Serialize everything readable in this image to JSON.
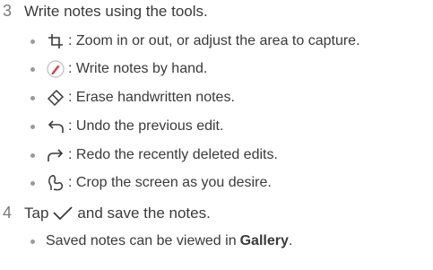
{
  "steps": [
    {
      "number": "3",
      "text": "Write notes using the tools.",
      "bullets": [
        {
          "icon": "crop-icon",
          "text": ": Zoom in or out, or adjust the area to capture."
        },
        {
          "icon": "pen-icon",
          "text": ": Write notes by hand."
        },
        {
          "icon": "eraser-icon",
          "text": ": Erase handwritten notes."
        },
        {
          "icon": "undo-icon",
          "text": ": Undo the previous edit."
        },
        {
          "icon": "redo-icon",
          "text": ": Redo the recently deleted edits."
        },
        {
          "icon": "lasso-icon",
          "text": ": Crop the screen as you desire."
        }
      ]
    },
    {
      "number": "4",
      "text_before": "Tap",
      "icon": "checkmark-icon",
      "text_after": "and save the notes.",
      "bullets": [
        {
          "text_before": "Saved notes can be viewed in",
          "bold": "Gallery",
          "text_after": "."
        }
      ]
    }
  ],
  "colors": {
    "text": "#3a3a3a",
    "icon": "#3a3a3a",
    "pen_accent": "#d9434b",
    "bullet": "#9a9a9a"
  }
}
